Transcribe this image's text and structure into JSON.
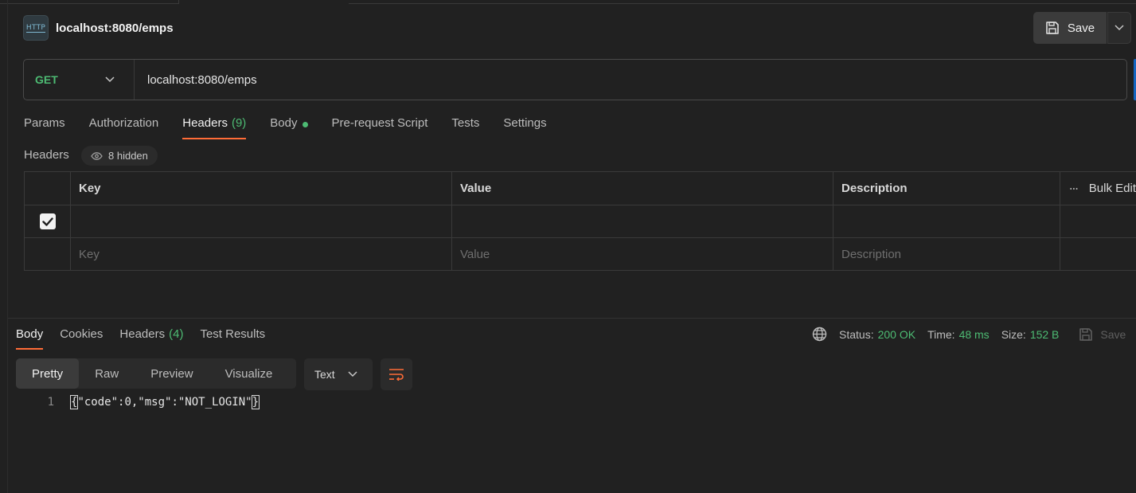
{
  "request": {
    "title": "localhost:8080/emps",
    "save_label": "Save",
    "method": "GET",
    "url": "localhost:8080/emps"
  },
  "request_tabs": [
    {
      "label": "Params"
    },
    {
      "label": "Authorization"
    },
    {
      "label": "Headers",
      "count": "(9)"
    },
    {
      "label": "Body"
    },
    {
      "label": "Pre-request Script"
    },
    {
      "label": "Tests"
    },
    {
      "label": "Settings"
    }
  ],
  "headers_section": {
    "label": "Headers",
    "hidden_label": "8 hidden",
    "columns": {
      "key": "Key",
      "value": "Value",
      "description": "Description",
      "bulk_edit": "Bulk Edit"
    },
    "rows": [
      {
        "checked": true,
        "key": "",
        "value": "",
        "description": ""
      }
    ],
    "placeholders": {
      "key": "Key",
      "value": "Value",
      "description": "Description"
    }
  },
  "response": {
    "tabs": [
      {
        "label": "Body"
      },
      {
        "label": "Cookies"
      },
      {
        "label": "Headers",
        "count": "(4)"
      },
      {
        "label": "Test Results"
      }
    ],
    "status_label": "Status:",
    "status_value": "200 OK",
    "time_label": "Time:",
    "time_value": "48 ms",
    "size_label": "Size:",
    "size_value": "152 B",
    "save_label": "Save",
    "formats": [
      "Pretty",
      "Raw",
      "Preview",
      "Visualize"
    ],
    "type_select": "Text",
    "code_lines": [
      {
        "number": "1",
        "text": "\"code\":0,\"msg\":\"NOT_LOGIN\""
      }
    ]
  },
  "colors": {
    "accent": "#ff6c37",
    "success": "#4dbb73",
    "background": "#212121"
  }
}
